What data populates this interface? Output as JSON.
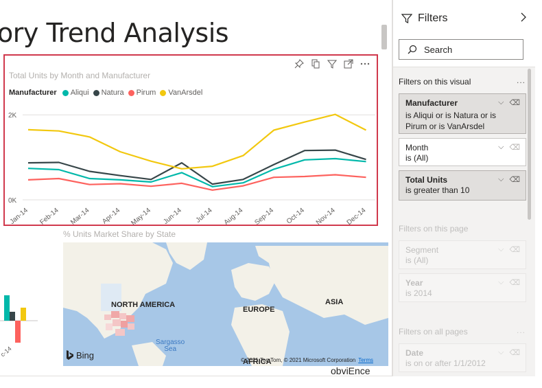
{
  "page": {
    "title": "ory Trend Analysis"
  },
  "line_visual": {
    "title": "Total Units by Month and Manufacturer",
    "toolbar": [
      "pin-icon",
      "copy-icon",
      "filter-icon",
      "focus-mode-icon",
      "more-options-icon"
    ],
    "legend_title": "Manufacturer"
  },
  "chart_data": {
    "type": "line",
    "title": "Total Units by Month and Manufacturer",
    "xlabel": "",
    "ylabel": "",
    "categories": [
      "Jan-14",
      "Feb-14",
      "Mar-14",
      "Apr-14",
      "May-14",
      "Jun-14",
      "Jul-14",
      "Aug-14",
      "Sep-14",
      "Oct-14",
      "Nov-14",
      "Dec-14"
    ],
    "yticks": [
      {
        "value": 0,
        "label": "0K"
      },
      {
        "value": 2000,
        "label": "2K"
      }
    ],
    "ylim": [
      0,
      2100
    ],
    "grid": true,
    "legend": "top-left",
    "series": [
      {
        "name": "Aliqui",
        "color": "#01b8aa",
        "values": [
          740,
          710,
          500,
          470,
          420,
          640,
          310,
          400,
          720,
          940,
          970,
          900
        ]
      },
      {
        "name": "Natura",
        "color": "#374649",
        "values": [
          870,
          880,
          670,
          570,
          480,
          870,
          370,
          480,
          830,
          1160,
          1170,
          950
        ]
      },
      {
        "name": "Pirum",
        "color": "#fd625e",
        "values": [
          470,
          500,
          360,
          380,
          320,
          390,
          230,
          330,
          530,
          550,
          590,
          530
        ]
      },
      {
        "name": "VanArsdel",
        "color": "#f2c80f",
        "values": [
          1650,
          1620,
          1480,
          1130,
          910,
          730,
          790,
          1040,
          1640,
          1830,
          2010,
          1640
        ]
      }
    ]
  },
  "map_visual": {
    "title": "% Units Market Share by State",
    "labels": {
      "north_america": "NORTH AMERICA",
      "europe": "EUROPE",
      "asia": "ASIA",
      "africa": "AFRICA",
      "sargasso": "Sargasso",
      "sea": "Sea"
    },
    "bing": "Bing",
    "copyright": "© 2021 TomTom, © 2021 Microsoft Corporation",
    "terms": "Terms"
  },
  "partial_visuals": {
    "tick": "c-14",
    "bottom_text": "obviEnce"
  },
  "filters": {
    "title": "Filters",
    "search_placeholder": "Search",
    "section_visual": "Filters on this visual",
    "section_page": "Filters on this page",
    "section_all": "Filters on all pages",
    "more": "...",
    "cards_visual": [
      {
        "name": "Manufacturer",
        "desc": "is Aliqui or is Natura or is Pirum or is VanArsdel"
      },
      {
        "name": "Month",
        "desc": "is (All)"
      },
      {
        "name": "Total Units",
        "desc": "is greater than 10"
      }
    ],
    "cards_page": [
      {
        "name": "Segment",
        "desc": "is (All)"
      },
      {
        "name": "Year",
        "desc": "is 2014"
      }
    ],
    "cards_all": [
      {
        "name": "Date",
        "desc": "is on or after 1/1/2012"
      }
    ]
  }
}
